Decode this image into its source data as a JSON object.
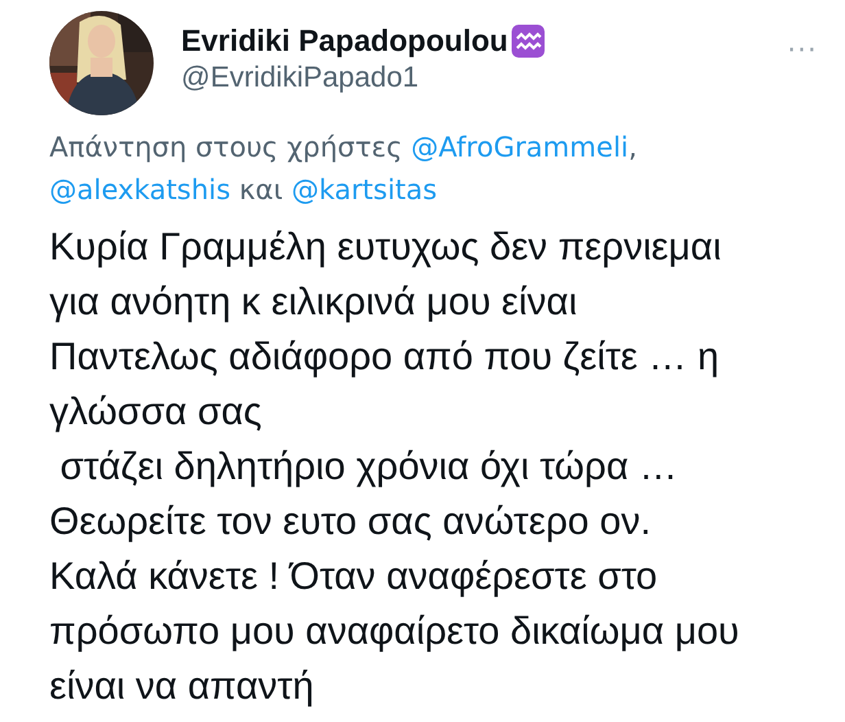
{
  "author": {
    "name": "Evridiki Papadopoulou",
    "handle": "@EvridikiPapado1"
  },
  "more": "···",
  "reply_to": [
    {
      "kind": "text",
      "text": "Απάντηση στους χρήστες "
    },
    {
      "kind": "mention",
      "text": "@AfroGrammeli"
    },
    {
      "kind": "text",
      "text": ", "
    },
    {
      "kind": "mention",
      "text": "@alexkatshis"
    },
    {
      "kind": "text",
      "text": " και "
    },
    {
      "kind": "mention",
      "text": "@kartsitas"
    }
  ],
  "text_lines": [
    "Κυρία Γραμμέλη ευτυχως δεν περνιεμαι",
    "για ανόητη κ ειλικρινά μου είναι",
    "Παντελως αδιάφορο από που ζείτε … η",
    "γλώσσα σας",
    " στάζει δηλητήριο χρόνια όχι τώρα …",
    "Θεωρείτε τον ευτο σας ανώτερο ον.",
    "Καλά κάνετε ! Όταν αναφέρεστε στο",
    "πρόσωπο μου αναφαίρετο δικαίωμα μου",
    "είναι να απαντή"
  ]
}
